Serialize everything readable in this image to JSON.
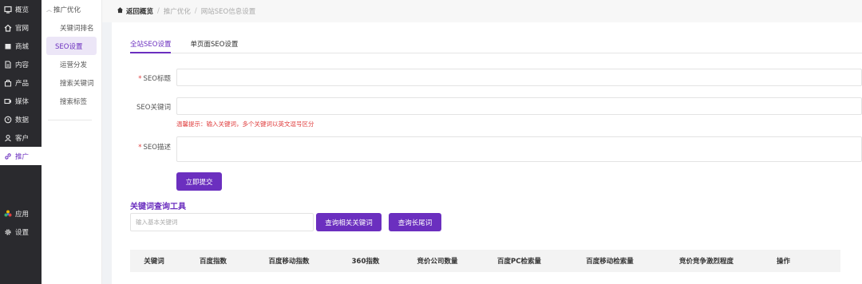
{
  "sidebar": {
    "items": [
      {
        "label": "概览",
        "icon": "dashboard-icon"
      },
      {
        "label": "官网",
        "icon": "home-icon"
      },
      {
        "label": "商城",
        "icon": "shop-icon"
      },
      {
        "label": "内容",
        "icon": "document-icon"
      },
      {
        "label": "产品",
        "icon": "product-icon"
      },
      {
        "label": "媒体",
        "icon": "media-icon"
      },
      {
        "label": "数据",
        "icon": "clock-icon"
      },
      {
        "label": "客户",
        "icon": "user-icon"
      },
      {
        "label": "推广",
        "icon": "link-icon"
      }
    ],
    "bottom": [
      {
        "label": "应用",
        "icon": "apps-icon"
      },
      {
        "label": "设置",
        "icon": "gear-icon"
      }
    ]
  },
  "submenu": {
    "head": "推广优化",
    "items": [
      "关键词排名",
      "SEO设置",
      "运营分发",
      "搜索关键词",
      "搜索标签"
    ]
  },
  "breadcrumb": {
    "home": "返回概览",
    "sep": "/",
    "items": [
      "推广优化",
      "网站SEO信息设置"
    ]
  },
  "tabs": [
    "全站SEO设置",
    "单页面SEO设置"
  ],
  "form": {
    "title_label": "SEO标题",
    "keywords_label": "SEO关键词",
    "keywords_hint": "温馨提示：输入关键词，多个关键词以英文逗号区分",
    "desc_label": "SEO描述",
    "required_mark": "*",
    "submit_label": "立即提交"
  },
  "keyword_tool": {
    "title": "关键词查询工具",
    "placeholder": "输入基本关键词",
    "btn_related": "查询相关关键词",
    "btn_longtail": "查询长尾词"
  },
  "table": {
    "headers": [
      "关键词",
      "百度指数",
      "百度移动指数",
      "360指数",
      "竞价公司数量",
      "百度PC检索量",
      "百度移动检索量",
      "竞价竞争激烈程度",
      "操作"
    ]
  },
  "colors": {
    "accent": "#6b2fbf",
    "sidebar_bg": "#2a2a2e",
    "warning": "#e04040"
  }
}
